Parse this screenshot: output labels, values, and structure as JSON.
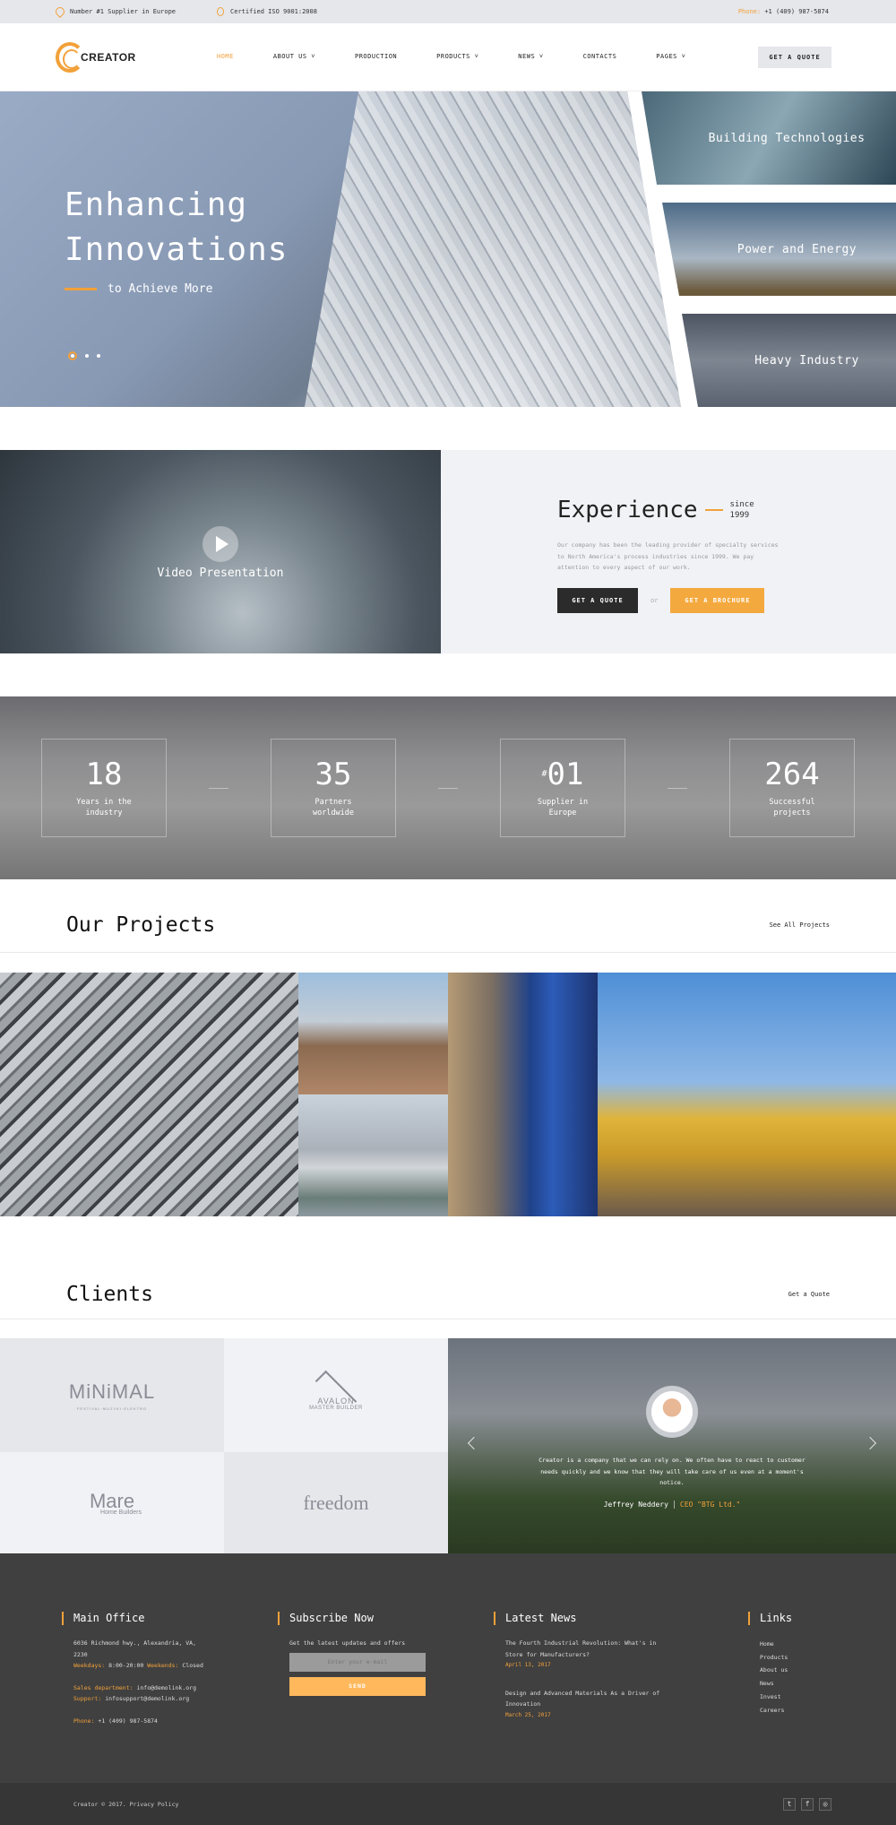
{
  "topbar": {
    "supplier": "Number #1 Supplier in Europe",
    "certified": "Certified ISO 9001:2008",
    "phone_label": "Phone:",
    "phone": "+1 (409) 987-5874"
  },
  "header": {
    "logo": "CREATOR",
    "nav": [
      {
        "label": "HOME",
        "active": true
      },
      {
        "label": "ABOUT US ˅"
      },
      {
        "label": "PRODUCTION"
      },
      {
        "label": "PRODUCTS ˅"
      },
      {
        "label": "NEWS ˅"
      },
      {
        "label": "CONTACTS"
      },
      {
        "label": "PAGES ˅"
      }
    ],
    "quote_button": "GET A QUOTE"
  },
  "hero": {
    "title_line1": "Enhancing",
    "title_line2": "Innovations",
    "subtitle": "to Achieve More",
    "slides": 3,
    "active_slide": 1,
    "panels": [
      "Building Technologies",
      "Power and Energy",
      "Heavy Industry"
    ]
  },
  "experience": {
    "video_label": "Video Presentation",
    "title": "Experience",
    "since_word": "since",
    "since_year": "1999",
    "text": "Our company has been the leading provider of specialty services to North America's process industries since 1999. We pay attention to every aspect of our work.",
    "quote_button": "GET A QUOTE",
    "or": "or",
    "brochure_button": "GET A BROCHURE"
  },
  "stats": [
    {
      "prefix": "",
      "value": "18",
      "label": "Years in the industry"
    },
    {
      "prefix": "",
      "value": "35",
      "label": "Partners worldwide"
    },
    {
      "prefix": "#",
      "value": "01",
      "label": "Supplier in Europe"
    },
    {
      "prefix": "",
      "value": "264",
      "label": "Successful projects"
    }
  ],
  "projects": {
    "title": "Our Projects",
    "link": "See All Projects"
  },
  "clients": {
    "title": "Clients",
    "link": "Get a Quote",
    "logos": {
      "minimal": "MiNiMAL",
      "minimal_sub": "FESTIVAL·MUZYKI·ELEKTRO",
      "avalon": "AVALON",
      "avalon_sub": "MASTER BUILDER",
      "mare": "Mare",
      "mare_sub": "Home Builders",
      "freedom": "freedom"
    },
    "testimonial": {
      "quote": "Creator is a company that we can rely on. We often have to react to customer needs quickly and we know that they will take care of us even at a moment's notice.",
      "author": "Jeffrey Neddery",
      "role": "CEO \"BTG Ltd.\""
    }
  },
  "footer": {
    "office": {
      "title": "Main Office",
      "address": "6036 Richmond hwy., Alexandria, VA, 2230",
      "weekdays_label": "Weekdays:",
      "weekdays": "8:00-20:00",
      "weekends_label": "Weekends:",
      "weekends": "Closed",
      "sales_label": "Sales department:",
      "sales": "info@demolink.org",
      "support_label": "Support:",
      "support": "infosupport@demolink.org",
      "phone_label": "Phone:",
      "phone": "+1 (409) 987-5874"
    },
    "subscribe": {
      "title": "Subscribe Now",
      "text": "Get the latest updates and offers",
      "placeholder": "Enter your e-mail",
      "button": "SEND"
    },
    "news": {
      "title": "Latest News",
      "items": [
        {
          "title": "The Fourth Industrial Revolution: What's in Store for Manufacturers?",
          "date": "April 13, 2017"
        },
        {
          "title": "Design and Advanced Materials As a Driver of Innovation",
          "date": "March 25, 2017"
        }
      ]
    },
    "links": {
      "title": "Links",
      "items": [
        "Home",
        "Products",
        "About us",
        "News",
        "Invest",
        "Careers"
      ]
    },
    "copyright": "Creator © 2017.",
    "privacy": "Privacy Policy",
    "social": [
      "twitter-icon",
      "facebook-icon",
      "instagram-icon"
    ]
  }
}
